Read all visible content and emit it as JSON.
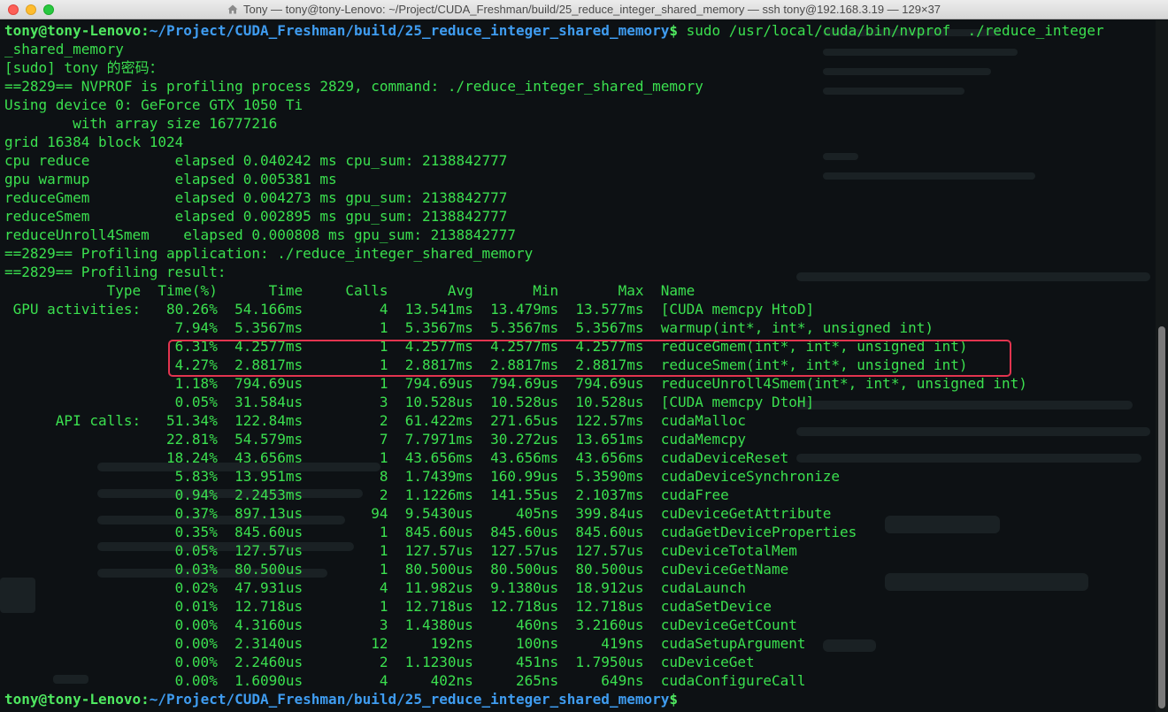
{
  "window": {
    "title": "Tony — tony@tony-Lenovo: ~/Project/CUDA_Freshman/build/25_reduce_integer_shared_memory — ssh tony@192.168.3.19 — 129×37",
    "home_icon": "home-icon"
  },
  "terminal": {
    "prompt_user": "tony@tony-Lenovo",
    "prompt_path": "~/Project/CUDA_Freshman/build/25_reduce_integer_shared_memory",
    "command_part1": "sudo /usr/local/cuda/bin/nvprof  ./reduce_integer",
    "command_part2": "_shared_memory",
    "output_lines": [
      "[sudo] tony 的密码：",
      "==2829== NVPROF is profiling process 2829, command: ./reduce_integer_shared_memory",
      "Using device 0: GeForce GTX 1050 Ti",
      "        with array size 16777216",
      "grid 16384 block 1024",
      "cpu reduce          elapsed 0.040242 ms cpu_sum: 2138842777",
      "gpu warmup          elapsed 0.005381 ms",
      "reduceGmem          elapsed 0.004273 ms gpu_sum: 2138842777",
      "reduceSmem          elapsed 0.002895 ms gpu_sum: 2138842777",
      "reduceUnroll4Smem    elapsed 0.000808 ms gpu_sum: 2138842777",
      "==2829== Profiling application: ./reduce_integer_shared_memory",
      "==2829== Profiling result:",
      "            Type  Time(%)      Time     Calls       Avg       Min       Max  Name",
      " GPU activities:   80.26%  54.166ms         4  13.541ms  13.479ms  13.577ms  [CUDA memcpy HtoD]",
      "                    7.94%  5.3567ms         1  5.3567ms  5.3567ms  5.3567ms  warmup(int*, int*, unsigned int)",
      "                    6.31%  4.2577ms         1  4.2577ms  4.2577ms  4.2577ms  reduceGmem(int*, int*, unsigned int)",
      "                    4.27%  2.8817ms         1  2.8817ms  2.8817ms  2.8817ms  reduceSmem(int*, int*, unsigned int)",
      "                    1.18%  794.69us         1  794.69us  794.69us  794.69us  reduceUnroll4Smem(int*, int*, unsigned int)",
      "                    0.05%  31.584us         3  10.528us  10.528us  10.528us  [CUDA memcpy DtoH]",
      "      API calls:   51.34%  122.84ms         2  61.422ms  271.65us  122.57ms  cudaMalloc",
      "                   22.81%  54.579ms         7  7.7971ms  30.272us  13.651ms  cudaMemcpy",
      "                   18.24%  43.656ms         1  43.656ms  43.656ms  43.656ms  cudaDeviceReset",
      "                    5.83%  13.951ms         8  1.7439ms  160.99us  5.3590ms  cudaDeviceSynchronize",
      "                    0.94%  2.2453ms         2  1.1226ms  141.55us  2.1037ms  cudaFree",
      "                    0.37%  897.13us        94  9.5430us     405ns  399.84us  cuDeviceGetAttribute",
      "                    0.35%  845.60us         1  845.60us  845.60us  845.60us  cudaGetDeviceProperties",
      "                    0.05%  127.57us         1  127.57us  127.57us  127.57us  cuDeviceTotalMem",
      "                    0.03%  80.500us         1  80.500us  80.500us  80.500us  cuDeviceGetName",
      "                    0.02%  47.931us         4  11.982us  9.1380us  18.912us  cudaLaunch",
      "                    0.01%  12.718us         1  12.718us  12.718us  12.718us  cudaSetDevice",
      "                    0.00%  4.3160us         3  1.4380us     460ns  3.2160us  cuDeviceGetCount",
      "                    0.00%  2.3140us        12     192ns     100ns     419ns  cudaSetupArgument",
      "                    0.00%  2.2460us         2  1.1230us     451ns  1.7950us  cuDeviceGet",
      "                    0.00%  1.6090us         4     402ns     265ns     649ns  cudaConfigureCall"
    ],
    "highlight_color": "#e2344f",
    "text_color": "#3be04f",
    "path_color": "#3f9cf0"
  }
}
